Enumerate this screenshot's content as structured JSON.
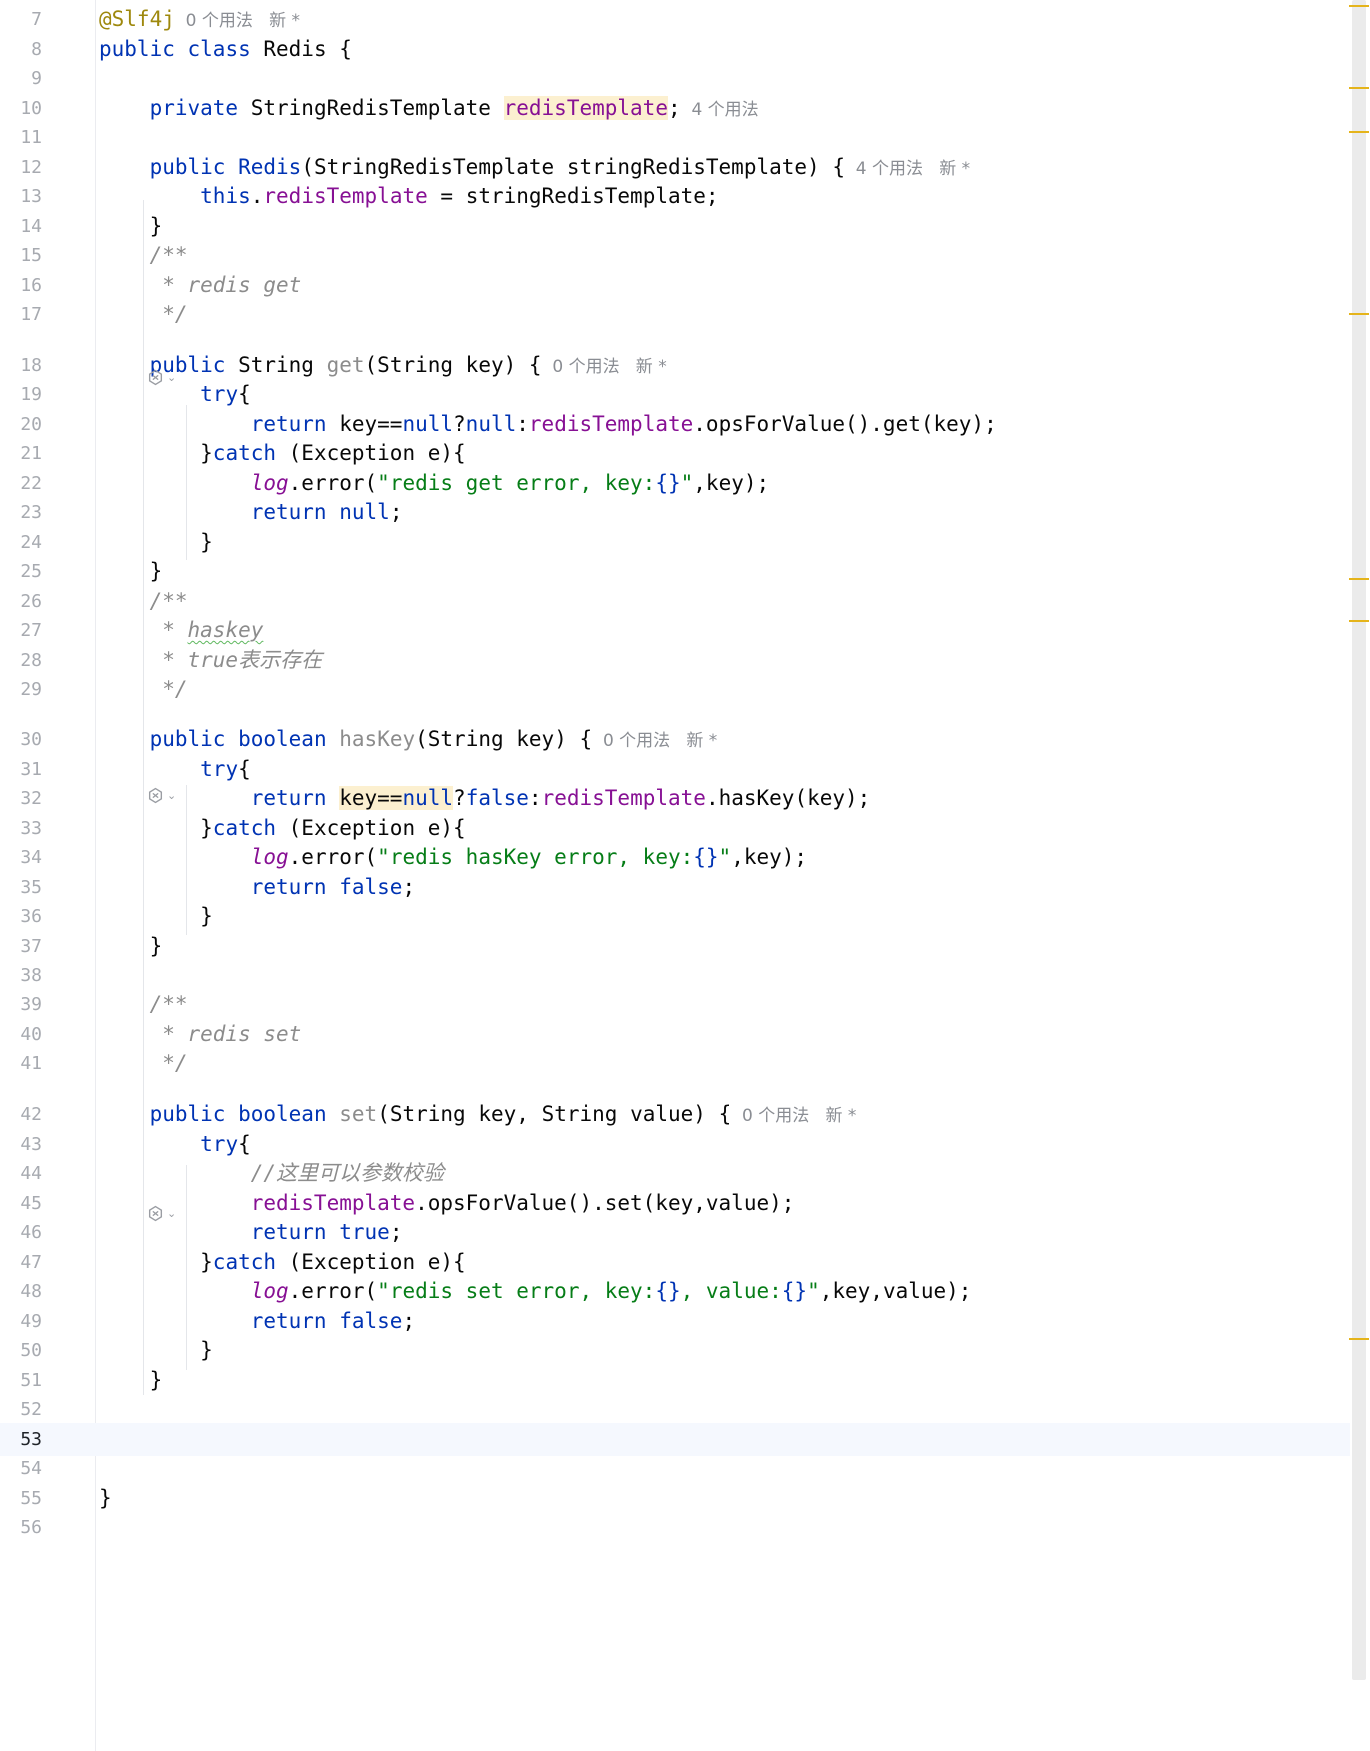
{
  "editor": {
    "current_line": "53",
    "hints": {
      "u0_new": "0 个用法   新 *",
      "u4": "4 个用法",
      "u4_new": "4 个用法   新 *"
    },
    "lines": [
      {
        "n": "7",
        "code": "@Slf4j"
      },
      {
        "n": "8",
        "code": "public class Redis {"
      },
      {
        "n": "9",
        "code": ""
      },
      {
        "n": "10",
        "code": "    private StringRedisTemplate redisTemplate;"
      },
      {
        "n": "11",
        "code": ""
      },
      {
        "n": "12",
        "code": "    public Redis(StringRedisTemplate stringRedisTemplate) {"
      },
      {
        "n": "13",
        "code": "        this.redisTemplate = stringRedisTemplate;"
      },
      {
        "n": "14",
        "code": "    }"
      },
      {
        "n": "15",
        "code": "    /**"
      },
      {
        "n": "16",
        "code": "     * redis get"
      },
      {
        "n": "17",
        "code": "     */"
      },
      {
        "n": "18",
        "code": "    public String get(String key) {"
      },
      {
        "n": "19",
        "code": "        try{"
      },
      {
        "n": "20",
        "code": "            return key==null?null:redisTemplate.opsForValue().get(key);"
      },
      {
        "n": "21",
        "code": "        }catch (Exception e){"
      },
      {
        "n": "22",
        "code": "            log.error(\"redis get error, key:{}\",key);"
      },
      {
        "n": "23",
        "code": "            return null;"
      },
      {
        "n": "24",
        "code": "        }"
      },
      {
        "n": "25",
        "code": "    }"
      },
      {
        "n": "26",
        "code": "    /**"
      },
      {
        "n": "27",
        "code": "     * haskey"
      },
      {
        "n": "28",
        "code": "     * true表示存在"
      },
      {
        "n": "29",
        "code": "     */"
      },
      {
        "n": "30",
        "code": "    public boolean hasKey(String key) {"
      },
      {
        "n": "31",
        "code": "        try{"
      },
      {
        "n": "32",
        "code": "            return key==null?false:redisTemplate.hasKey(key);"
      },
      {
        "n": "33",
        "code": "        }catch (Exception e){"
      },
      {
        "n": "34",
        "code": "            log.error(\"redis hasKey error, key:{}\",key);"
      },
      {
        "n": "35",
        "code": "            return false;"
      },
      {
        "n": "36",
        "code": "        }"
      },
      {
        "n": "37",
        "code": "    }"
      },
      {
        "n": "38",
        "code": ""
      },
      {
        "n": "39",
        "code": "    /**"
      },
      {
        "n": "40",
        "code": "     * redis set"
      },
      {
        "n": "41",
        "code": "     */"
      },
      {
        "n": "42",
        "code": "    public boolean set(String key, String value) {"
      },
      {
        "n": "43",
        "code": "        try{"
      },
      {
        "n": "44",
        "code": "            //这里可以参数校验"
      },
      {
        "n": "45",
        "code": "            redisTemplate.opsForValue().set(key,value);"
      },
      {
        "n": "46",
        "code": "            return true;"
      },
      {
        "n": "47",
        "code": "        }catch (Exception e){"
      },
      {
        "n": "48",
        "code": "            log.error(\"redis set error, key:{}, value:{}\",key,value);"
      },
      {
        "n": "49",
        "code": "            return false;"
      },
      {
        "n": "50",
        "code": "        }"
      },
      {
        "n": "51",
        "code": "    }"
      },
      {
        "n": "52",
        "code": ""
      },
      {
        "n": "53",
        "code": ""
      },
      {
        "n": "54",
        "code": ""
      },
      {
        "n": "55",
        "code": "}"
      },
      {
        "n": "56",
        "code": ""
      }
    ]
  }
}
